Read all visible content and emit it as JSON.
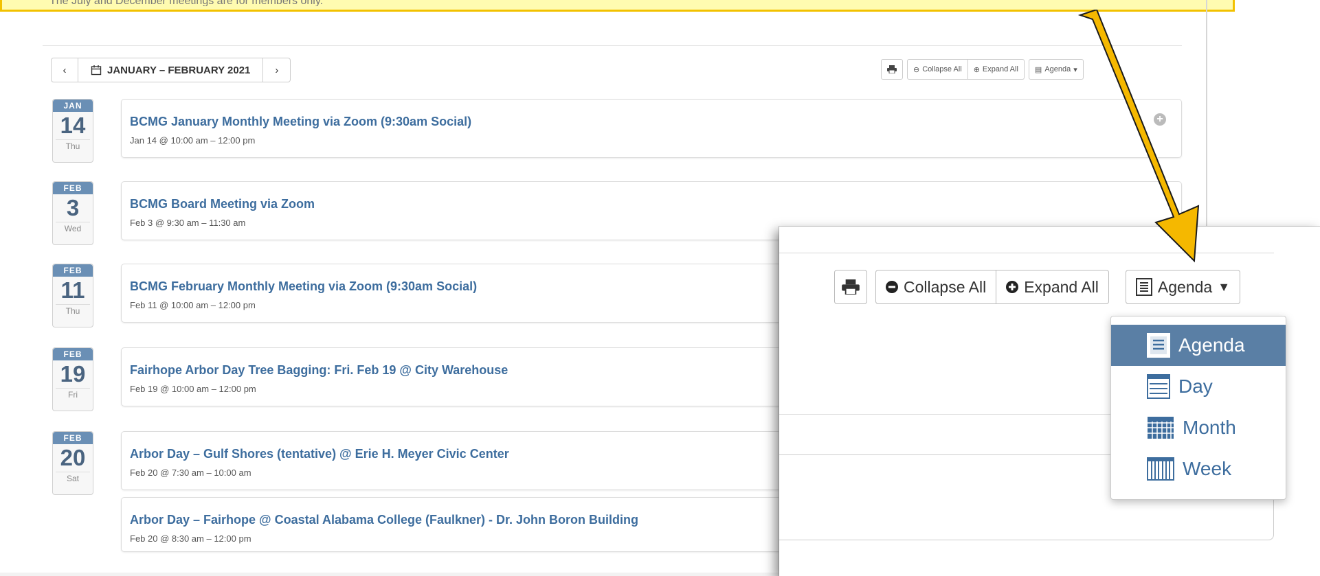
{
  "intro": {
    "note": "The July and December meetings are for members only."
  },
  "nav": {
    "prev_symbol": "‹",
    "next_symbol": "›",
    "range_label": "JANUARY – FEBRUARY 2021"
  },
  "toolbar": {
    "collapse_label": "Collapse All",
    "expand_label": "Expand All",
    "view_label": "Agenda"
  },
  "events": [
    {
      "month": "JAN",
      "day": "14",
      "dow": "Thu",
      "title": "BCMG January Monthly Meeting via Zoom (9:30am Social)",
      "time": "Jan 14 @ 10:00 am – 12:00 pm"
    },
    {
      "month": "FEB",
      "day": "3",
      "dow": "Wed",
      "title": "BCMG Board Meeting via Zoom",
      "time": "Feb 3 @ 9:30 am – 11:30 am"
    },
    {
      "month": "FEB",
      "day": "11",
      "dow": "Thu",
      "title": "BCMG February Monthly Meeting via Zoom (9:30am Social)",
      "time": "Feb 11 @ 10:00 am – 12:00 pm"
    },
    {
      "month": "FEB",
      "day": "19",
      "dow": "Fri",
      "title": "Fairhope Arbor Day Tree Bagging: Fri. Feb 19 @ City Warehouse",
      "time": "Feb 19 @ 10:00 am – 12:00 pm"
    },
    {
      "month": "FEB",
      "day": "20",
      "dow": "Sat",
      "title": "Arbor Day – Gulf Shores (tentative) @ Erie H. Meyer Civic Center",
      "time": "Feb 20 @ 7:30 am – 10:00 am"
    },
    {
      "title": "Arbor Day – Fairhope @ Coastal Alabama College (Faulkner) - Dr. John Boron Building",
      "time": "Feb 20 @ 8:30 am – 12:00 pm"
    }
  ],
  "zoom": {
    "collapse_label": "Collapse All",
    "expand_label": "Expand All",
    "view_label": "Agenda",
    "menu": [
      {
        "label": "Agenda",
        "icon": "agenda-icon",
        "active": true
      },
      {
        "label": "Day",
        "icon": "day-icon",
        "active": false
      },
      {
        "label": "Month",
        "icon": "month-icon",
        "active": false
      },
      {
        "label": "Week",
        "icon": "week-icon",
        "active": false
      }
    ]
  },
  "colors": {
    "accent": "#3d6d9e",
    "active_bg": "#5a7fa5",
    "arrow": "#f5b800",
    "note_bg": "#fffbb0"
  }
}
